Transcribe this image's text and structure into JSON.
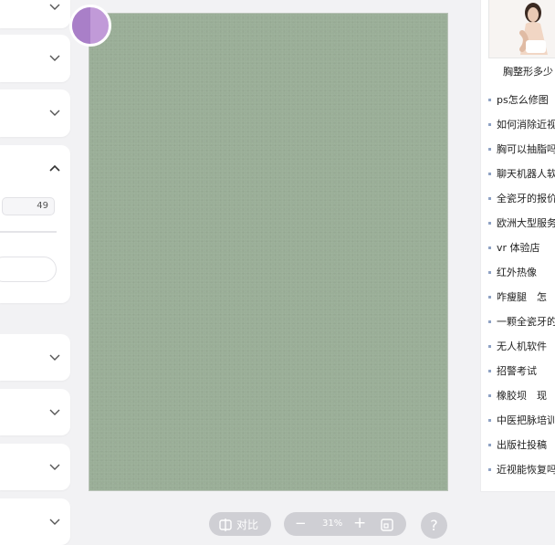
{
  "settings_panel": {
    "number_value": "49"
  },
  "toolbar": {
    "compare_label": "对比",
    "zoom_value": "31%",
    "zoom_minus": "−",
    "zoom_plus": "+",
    "help_label": "?"
  },
  "sidebar": {
    "featured_caption": "胸整形多少",
    "links": [
      "ps怎么修图",
      "如何消除近视",
      "胸可以抽脂吗",
      "聊天机器人软件",
      "全瓷牙的报价",
      "欧洲大型服务",
      "vr 体验店",
      "红外热像　",
      "咋瘦腿　怎",
      "一颗全瓷牙的",
      "无人机软件",
      "招警考试　",
      "橡胶坝　现",
      "中医把脉培训",
      "出版社投稿",
      "近视能恢复吗"
    ]
  },
  "colors": {
    "canvas": "#9aae97",
    "accent_purple": "#c19ad8",
    "toolbar_pill": "#cfcfd4"
  }
}
